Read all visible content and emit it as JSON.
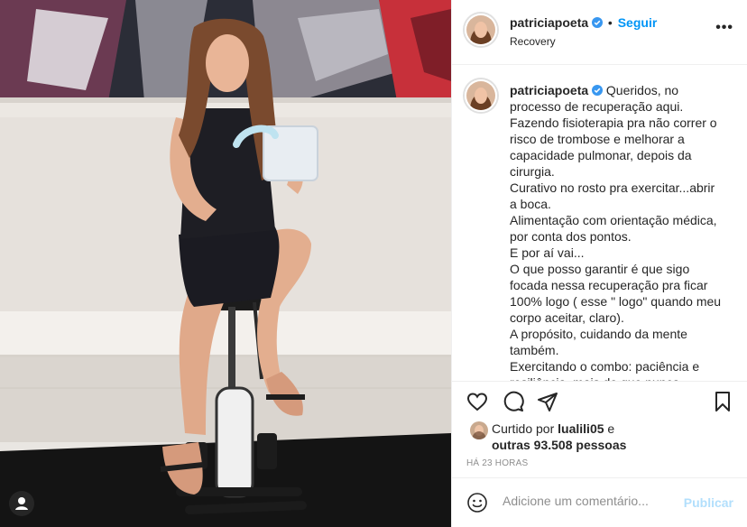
{
  "post": {
    "username": "patriciapoeta",
    "follow_label": "Seguir",
    "separator": "•",
    "location": "Recovery",
    "more_label": "•••"
  },
  "caption": {
    "username": "patriciapoeta",
    "lines": [
      "Queridos, no processo de recuperação aqui.",
      "Fazendo fisioterapia pra não correr o risco de trombose e melhorar a capacidade pulmonar, depois da cirurgia.",
      "Curativo no rosto pra exercitar...abrir a boca.",
      "Alimentação com orientação médica, por conta dos pontos.",
      "E por aí vai...",
      "O que posso garantir é que sigo focada nessa recuperação pra ficar 100% logo ( esse \" logo\" quando meu corpo aceitar, claro).",
      "A propósito, cuidando da mente também.",
      "Exercitando o combo: paciência e resiliência, mais do que nunca."
    ]
  },
  "likes": {
    "prefix": "Curtido por",
    "liker": "lualili05",
    "conj": "e",
    "others": "outras 93.508 pessoas"
  },
  "timestamp": "HÁ 23 HORAS",
  "comment_box": {
    "placeholder": "Adicione um comentário...",
    "post_label": "Publicar"
  },
  "icons": {
    "header_more": "more-options-icon",
    "verified": "verified-badge-icon",
    "like": "heart-icon",
    "comment": "comment-icon",
    "share": "paper-plane-icon",
    "save": "bookmark-icon",
    "emoji": "emoji-icon",
    "tagged": "tagged-people-icon"
  },
  "colors": {
    "accent": "#0095f6",
    "post_disabled": "#b2dffc",
    "text": "#262626",
    "muted": "#8e8e8e",
    "verified": "#3897f0"
  }
}
